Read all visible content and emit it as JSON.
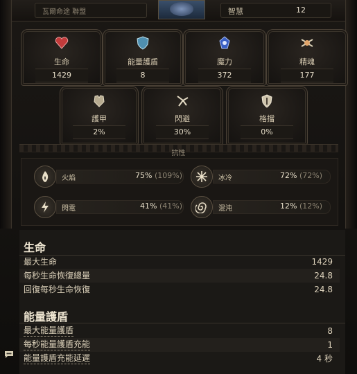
{
  "topbar": {
    "left_text": "瓦爾命途 聯盟",
    "stat_label": "智慧",
    "stat_value": "12"
  },
  "primary_stats": [
    {
      "label": "生命",
      "value": "1429",
      "icon": "heart-icon"
    },
    {
      "label": "能量護盾",
      "value": "8",
      "icon": "shield-icon"
    },
    {
      "label": "魔力",
      "value": "372",
      "icon": "mana-icon"
    },
    {
      "label": "精魂",
      "value": "177",
      "icon": "spirit-icon"
    }
  ],
  "defense_stats": [
    {
      "label": "護甲",
      "value": "2%",
      "icon": "armour-icon"
    },
    {
      "label": "閃避",
      "value": "30%",
      "icon": "evasion-icon"
    },
    {
      "label": "格擋",
      "value": "0%",
      "icon": "block-icon"
    }
  ],
  "resistances": {
    "title": "抗性",
    "items": [
      {
        "label": "火焰",
        "value": "75%",
        "max": "(109%)",
        "icon": "fire-icon"
      },
      {
        "label": "冰冷",
        "value": "72%",
        "max": "(72%)",
        "icon": "cold-icon"
      },
      {
        "label": "閃電",
        "value": "41%",
        "max": "(41%)",
        "icon": "lightning-icon"
      },
      {
        "label": "混沌",
        "value": "12%",
        "max": "(12%)",
        "icon": "chaos-icon"
      }
    ]
  },
  "life_section": {
    "title": "生命",
    "rows": [
      {
        "key": "最大生命",
        "value": "1429"
      },
      {
        "key": "每秒生命恢復總量",
        "value": "24.8"
      },
      {
        "key": "回復每秒生命恢復",
        "value": "24.8"
      }
    ]
  },
  "es_section": {
    "title": "能量護盾",
    "rows": [
      {
        "key": "最大能量護盾",
        "value": "8"
      },
      {
        "key": "每秒能量護盾充能",
        "value": "1"
      },
      {
        "key": "能量護盾充能延遲",
        "value": "4 秒"
      }
    ]
  },
  "colors": {
    "life": "#c23b3b",
    "es": "#4f8fb0",
    "mana": "#3a5fc4",
    "spirit": "#d8cfb5"
  }
}
